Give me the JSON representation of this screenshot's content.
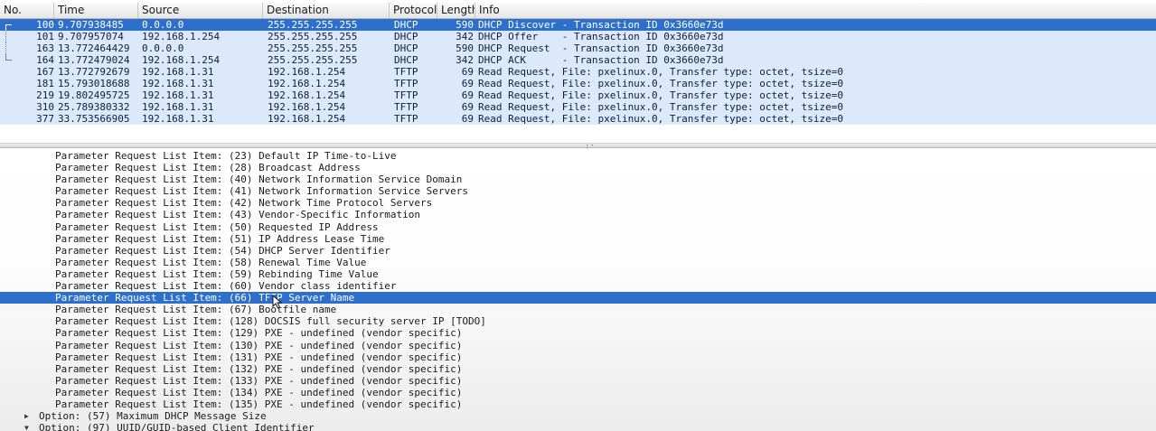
{
  "packet_list": {
    "columns": [
      "No.",
      "Time",
      "Source",
      "Destination",
      "Protocol",
      "Length",
      "Info"
    ],
    "rows": [
      {
        "no": "100",
        "time": "9.707938485",
        "src": "0.0.0.0",
        "dst": "255.255.255.255",
        "proto": "DHCP",
        "len": "590",
        "info": "DHCP Discover - Transaction ID 0x3660e73d",
        "selected": true
      },
      {
        "no": "101",
        "time": "9.707957074",
        "src": "192.168.1.254",
        "dst": "255.255.255.255",
        "proto": "DHCP",
        "len": "342",
        "info": "DHCP Offer    - Transaction ID 0x3660e73d",
        "selected": false
      },
      {
        "no": "163",
        "time": "13.772464429",
        "src": "0.0.0.0",
        "dst": "255.255.255.255",
        "proto": "DHCP",
        "len": "590",
        "info": "DHCP Request  - Transaction ID 0x3660e73d",
        "selected": false
      },
      {
        "no": "164",
        "time": "13.772479024",
        "src": "192.168.1.254",
        "dst": "255.255.255.255",
        "proto": "DHCP",
        "len": "342",
        "info": "DHCP ACK      - Transaction ID 0x3660e73d",
        "selected": false
      },
      {
        "no": "167",
        "time": "13.772792679",
        "src": "192.168.1.31",
        "dst": "192.168.1.254",
        "proto": "TFTP",
        "len": "69",
        "info": "Read Request, File: pxelinux.0, Transfer type: octet, tsize=0",
        "selected": false
      },
      {
        "no": "181",
        "time": "15.793018688",
        "src": "192.168.1.31",
        "dst": "192.168.1.254",
        "proto": "TFTP",
        "len": "69",
        "info": "Read Request, File: pxelinux.0, Transfer type: octet, tsize=0",
        "selected": false
      },
      {
        "no": "219",
        "time": "19.802495725",
        "src": "192.168.1.31",
        "dst": "192.168.1.254",
        "proto": "TFTP",
        "len": "69",
        "info": "Read Request, File: pxelinux.0, Transfer type: octet, tsize=0",
        "selected": false
      },
      {
        "no": "310",
        "time": "25.789380332",
        "src": "192.168.1.31",
        "dst": "192.168.1.254",
        "proto": "TFTP",
        "len": "69",
        "info": "Read Request, File: pxelinux.0, Transfer type: octet, tsize=0",
        "selected": false
      },
      {
        "no": "377",
        "time": "33.753566905",
        "src": "192.168.1.31",
        "dst": "192.168.1.254",
        "proto": "TFTP",
        "len": "69",
        "info": "Read Request, File: pxelinux.0, Transfer type: octet, tsize=0",
        "selected": false
      }
    ]
  },
  "details": {
    "lines": [
      {
        "text": "Parameter Request List Item: (23) Default IP Time-to-Live",
        "selected": false
      },
      {
        "text": "Parameter Request List Item: (28) Broadcast Address",
        "selected": false
      },
      {
        "text": "Parameter Request List Item: (40) Network Information Service Domain",
        "selected": false
      },
      {
        "text": "Parameter Request List Item: (41) Network Information Service Servers",
        "selected": false
      },
      {
        "text": "Parameter Request List Item: (42) Network Time Protocol Servers",
        "selected": false
      },
      {
        "text": "Parameter Request List Item: (43) Vendor-Specific Information",
        "selected": false
      },
      {
        "text": "Parameter Request List Item: (50) Requested IP Address",
        "selected": false
      },
      {
        "text": "Parameter Request List Item: (51) IP Address Lease Time",
        "selected": false
      },
      {
        "text": "Parameter Request List Item: (54) DHCP Server Identifier",
        "selected": false
      },
      {
        "text": "Parameter Request List Item: (58) Renewal Time Value",
        "selected": false
      },
      {
        "text": "Parameter Request List Item: (59) Rebinding Time Value",
        "selected": false
      },
      {
        "text": "Parameter Request List Item: (60) Vendor class identifier",
        "selected": false
      },
      {
        "text": "Parameter Request List Item: (66) TFTP Server Name",
        "selected": true
      },
      {
        "text": "Parameter Request List Item: (67) Bootfile name",
        "selected": false
      },
      {
        "text": "Parameter Request List Item: (128) DOCSIS full security server IP [TODO]",
        "selected": false
      },
      {
        "text": "Parameter Request List Item: (129) PXE - undefined (vendor specific)",
        "selected": false
      },
      {
        "text": "Parameter Request List Item: (130) PXE - undefined (vendor specific)",
        "selected": false
      },
      {
        "text": "Parameter Request List Item: (131) PXE - undefined (vendor specific)",
        "selected": false
      },
      {
        "text": "Parameter Request List Item: (132) PXE - undefined (vendor specific)",
        "selected": false
      },
      {
        "text": "Parameter Request List Item: (133) PXE - undefined (vendor specific)",
        "selected": false
      },
      {
        "text": "Parameter Request List Item: (134) PXE - undefined (vendor specific)",
        "selected": false
      },
      {
        "text": "Parameter Request List Item: (135) PXE - undefined (vendor specific)",
        "selected": false
      }
    ],
    "options": [
      {
        "text": "Option: (57) Maximum DHCP Message Size",
        "expanded": false
      },
      {
        "text": "Option: (97) UUID/GUID-based Client Identifier",
        "expanded": true
      }
    ]
  },
  "colors": {
    "row_bg": "#dbe9fb",
    "selected_bg": "#2f6fcc",
    "selected_fg": "#ffffff"
  },
  "icons": {
    "collapsed": "triangle-right-icon",
    "expanded": "triangle-down-icon",
    "cursor": "mouse-pointer-icon"
  }
}
